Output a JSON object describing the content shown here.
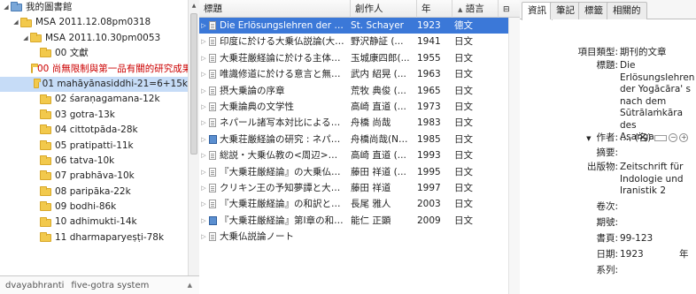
{
  "tree": {
    "items": [
      {
        "label": "我的圖書館",
        "level": 0,
        "expanded": true,
        "type": "library"
      },
      {
        "label": "MSA 2011.12.08pm0318",
        "level": 1,
        "expanded": true,
        "type": "folder"
      },
      {
        "label": "MSA 2011.10.30pm0053",
        "level": 2,
        "expanded": true,
        "type": "folder"
      },
      {
        "label": "00 文獻",
        "level": 3,
        "type": "folder"
      },
      {
        "label": "00 尚無限制與第一品有關的研究成果",
        "level": 3,
        "type": "folder",
        "red": true
      },
      {
        "label": "01 mahāyānasiddhi-21=6+15k",
        "level": 3,
        "type": "folder",
        "selected": true
      },
      {
        "label": "02 śaraṇagamana-12k",
        "level": 3,
        "type": "folder"
      },
      {
        "label": "03 gotra-13k",
        "level": 3,
        "type": "folder"
      },
      {
        "label": "04 cittotpāda-28k",
        "level": 3,
        "type": "folder"
      },
      {
        "label": "05 pratipatti-11k",
        "level": 3,
        "type": "folder"
      },
      {
        "label": "06 tatva-10k",
        "level": 3,
        "type": "folder"
      },
      {
        "label": "07 prabhāva-10k",
        "level": 3,
        "type": "folder"
      },
      {
        "label": "08 paripāka-22k",
        "level": 3,
        "type": "folder"
      },
      {
        "label": "09 bodhi-86k",
        "level": 3,
        "type": "folder"
      },
      {
        "label": "10 adhimukti-14k",
        "level": 3,
        "type": "folder"
      },
      {
        "label": "11 dharmaparyeṣṭi-78k",
        "level": 3,
        "type": "folder"
      }
    ]
  },
  "tags": [
    "dvayabhranti",
    "five-gotra system"
  ],
  "columns": {
    "title": "標題",
    "creator": "創作人",
    "year": "年",
    "language": "語言"
  },
  "items": [
    {
      "title": "Die Erlösungslehren der Yogācāra' s n...",
      "creator": "St. Schayer",
      "year": "1923",
      "language": "德文",
      "icon": "doc",
      "selected": true
    },
    {
      "title": "印度に於ける大乗仏説論(大乗荘厳...",
      "creator": "野沢静証 (...",
      "year": "1941",
      "language": "日文",
      "icon": "doc"
    },
    {
      "title": "大乗荘厳経論に於ける主体性の意味 / On...",
      "creator": "玉城康四郎(...",
      "year": "1955",
      "language": "日文",
      "icon": "doc"
    },
    {
      "title": "唯識修道に於ける意言と無分別智---摂大...",
      "creator": "武内 紹晃 (...",
      "year": "1963",
      "language": "日文",
      "icon": "doc"
    },
    {
      "title": "摂大乗論の序章",
      "creator": "荒牧 典俊 (...",
      "year": "1965",
      "language": "日文",
      "icon": "doc"
    },
    {
      "title": "大乗論典の文学性",
      "creator": "高崎 直道 (...",
      "year": "1973",
      "language": "日文",
      "icon": "doc"
    },
    {
      "title": "ネパール諸写本対比による大乗荘厳経論の...",
      "creator": "舟橋 尚哉",
      "year": "1983",
      "language": "日文",
      "icon": "doc"
    },
    {
      "title": "大乗荘厳経論の研究 : ネパール写本対照...",
      "creator": "舟橋尚哉(Na...",
      "year": "1985",
      "language": "日文",
      "icon": "book"
    },
    {
      "title": "総説・大乗仏教の<周辺>―補論・大乗非...",
      "creator": "高崎 直道 (...",
      "year": "1993",
      "language": "日文",
      "icon": "doc"
    },
    {
      "title": "『大乗荘厳経論』の大乗仏説論に対する...",
      "creator": "藤田 祥道 (...",
      "year": "1995",
      "language": "日文",
      "icon": "doc"
    },
    {
      "title": "クリキン王の予知夢譚と大乗仏説論―『...",
      "creator": "藤田 祥道",
      "year": "1997",
      "language": "日文",
      "icon": "doc"
    },
    {
      "title": "『大乗荘厳経論』の和訳と注解―第一章...",
      "creator": "長尾 雅人",
      "year": "2003",
      "language": "日文",
      "icon": "doc"
    },
    {
      "title": "『大乗荘厳経論』第I章の和訳と注解: 大...",
      "creator": "能仁 正顕",
      "year": "2009",
      "language": "日文",
      "icon": "book"
    },
    {
      "title": "大乗仏説論ノート",
      "creator": "",
      "year": "",
      "language": "",
      "icon": "doc"
    }
  ],
  "tabs": [
    "資訊",
    "筆記",
    "標籤",
    "相關的"
  ],
  "info": {
    "item_type_label": "項目類型:",
    "item_type": "期刊的文章",
    "title_label": "標題:",
    "title_lines": [
      "Die",
      "Erlösungslehren",
      "der Yogācāra' s",
      "nach dem",
      "Sūtrālaṁkāra des",
      "Asaṅga"
    ],
    "author_label": "作者:",
    "author_value": "..., (名)",
    "abstract_label": "摘要:",
    "publication_label": "出版物:",
    "publication_lines": [
      "Zeitschrift für",
      "Indologie und",
      "Iranistik 2"
    ],
    "volume_label": "卷次:",
    "issue_label": "期號:",
    "pages_label": "書頁:",
    "pages": "99-123",
    "date_label": "日期:",
    "date": "1923",
    "date_unit": "年",
    "series_label": "系列:"
  }
}
